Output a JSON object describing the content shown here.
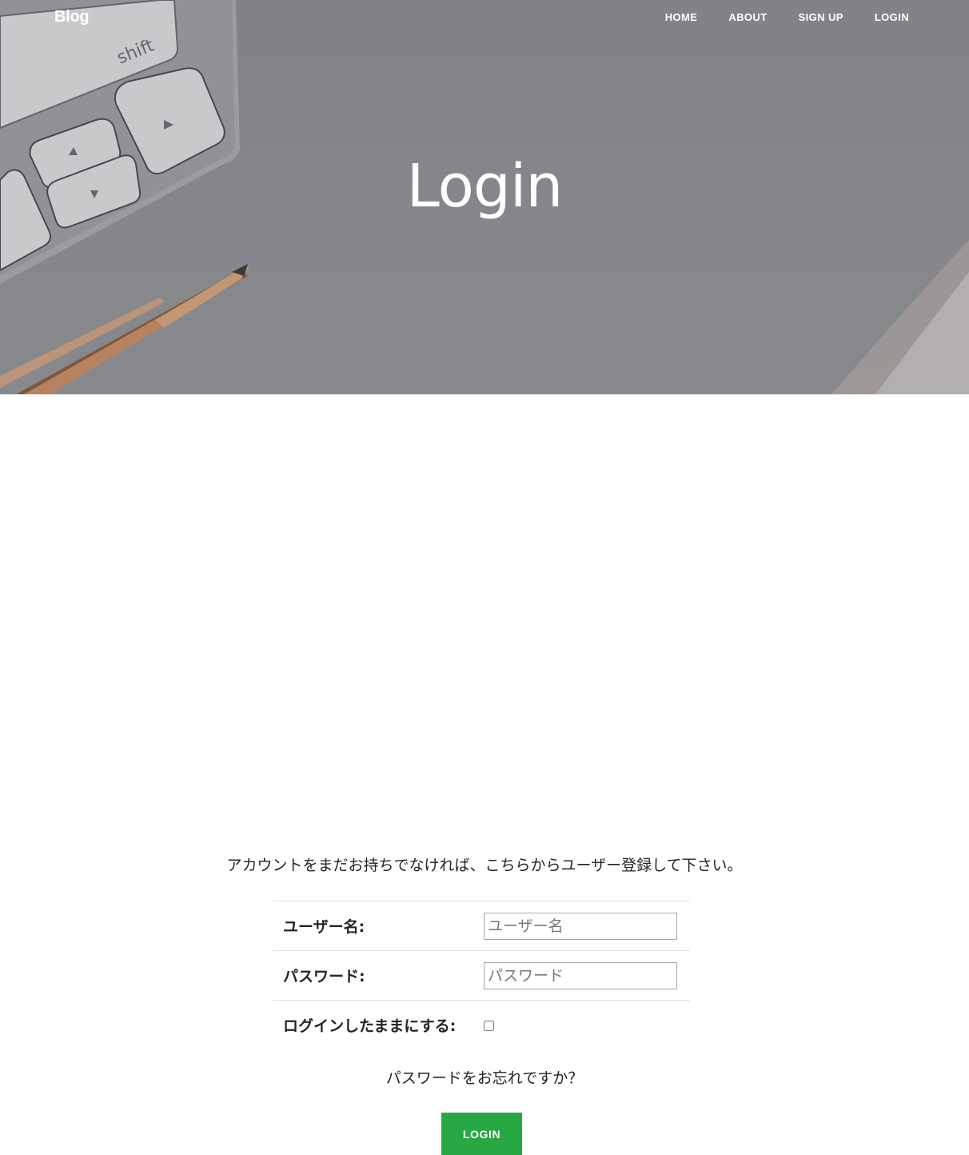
{
  "navbar": {
    "brand": "Blog",
    "links": [
      "HOME",
      "ABOUT",
      "SIGN UP",
      "LOGIN"
    ]
  },
  "hero": {
    "title": "Login",
    "keyboard_key_label": "shift"
  },
  "form": {
    "signup_note": "アカウントをまだお持ちでなければ、こちらからユーザー登録して下さい。",
    "username_label": "ユーザー名:",
    "username_placeholder": "ユーザー名",
    "password_label": "パスワード:",
    "password_placeholder": "パスワード",
    "remember_label": "ログインしたままにする:",
    "remember_checked": false,
    "forgot_link": "パスワードをお忘れですか？",
    "submit_label": "LOGIN"
  },
  "colors": {
    "accent_button": "#28a745",
    "hero_overlay": "#8f9096"
  }
}
